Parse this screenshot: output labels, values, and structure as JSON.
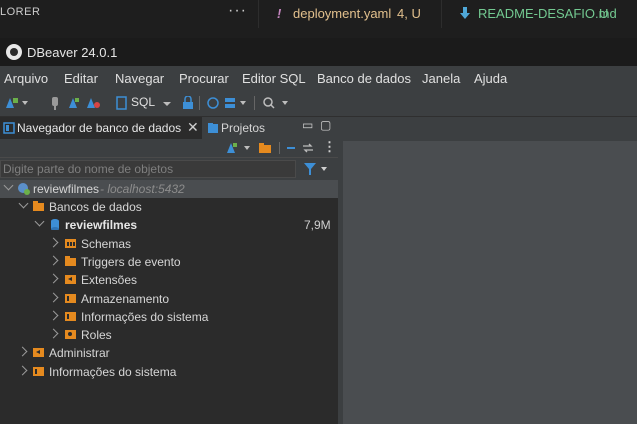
{
  "vscode": {
    "explorer_label": "LORER",
    "more": "···",
    "tabs": [
      {
        "icon": "!",
        "name": "deployment.yaml",
        "status": "4, U"
      },
      {
        "icon": "download-arrow",
        "name": "README-DESAFIO.md",
        "status": "U"
      }
    ]
  },
  "app": {
    "title": "DBeaver 24.0.1"
  },
  "menu": [
    "Arquivo",
    "Editar",
    "Navegar",
    "Procurar",
    "Editor SQL",
    "Banco de dados",
    "Janela",
    "Ajuda"
  ],
  "toolbar": {
    "sql_label": "SQL"
  },
  "panel": {
    "tab_navigator": "Navegador de banco de dados",
    "tab_projects": "Projetos",
    "filter_placeholder": "Digite parte do nome de objetos"
  },
  "tree": [
    {
      "label": "reviewfilmes",
      "detail": " - localhost:5432",
      "icon": "postgres-connection-icon",
      "expanded": true
    },
    {
      "label": "Bancos de dados",
      "icon": "folder-icon",
      "expanded": true
    },
    {
      "label": "reviewfilmes",
      "size": "7,9M",
      "icon": "database-icon",
      "expanded": true
    },
    {
      "label": "Schemas",
      "icon": "schemas-icon"
    },
    {
      "label": "Triggers de evento",
      "icon": "triggers-icon"
    },
    {
      "label": "Extensões",
      "icon": "extensions-icon"
    },
    {
      "label": "Armazenamento",
      "icon": "storage-icon"
    },
    {
      "label": "Informações do sistema",
      "icon": "info-icon"
    },
    {
      "label": "Roles",
      "icon": "roles-icon"
    },
    {
      "label": "Administrar",
      "icon": "admin-icon"
    },
    {
      "label": "Informações do sistema",
      "icon": "info-icon"
    }
  ],
  "colors": {
    "accent": "#e58a1f",
    "blue": "#3d8fd6",
    "yaml": "#c9a3e6"
  }
}
